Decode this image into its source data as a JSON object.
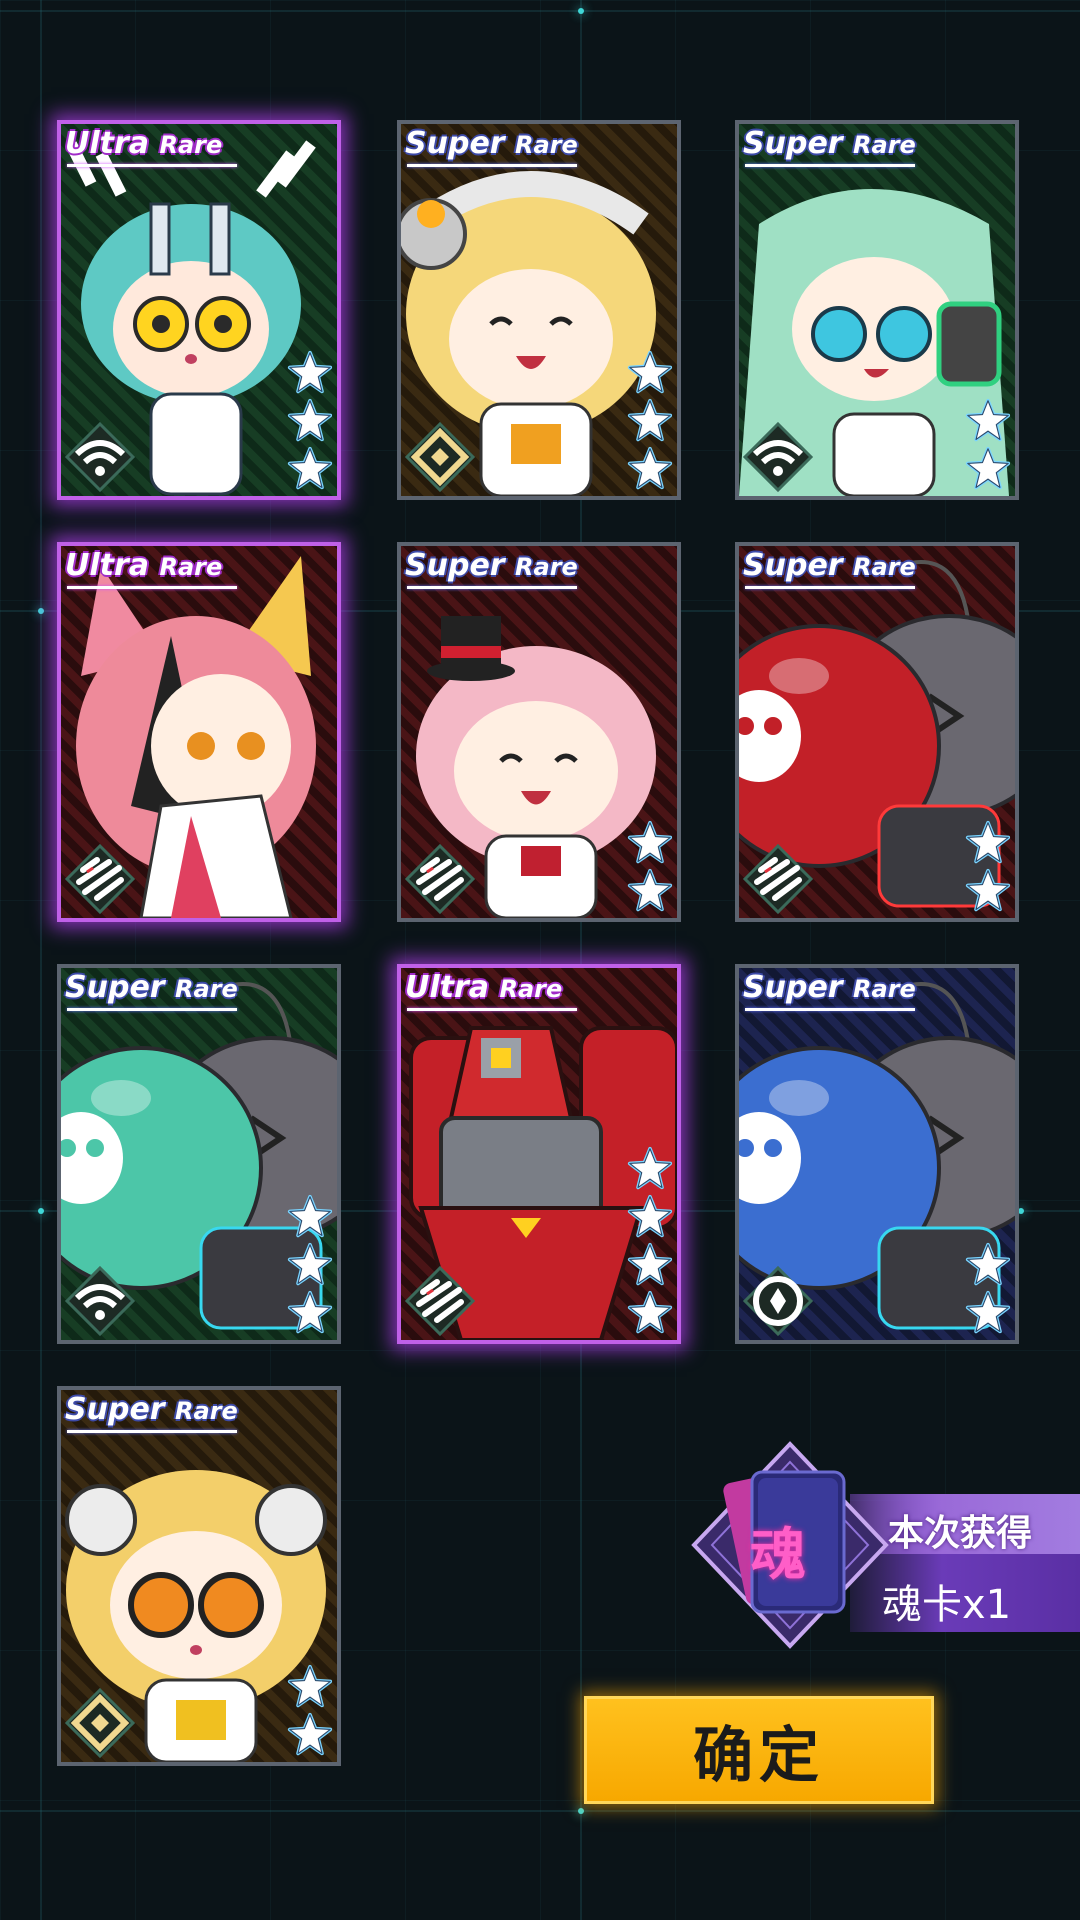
{
  "cards": [
    {
      "rarity_word1": "Ultra",
      "rarity_word2": "Rare",
      "tier": "ur",
      "stars": 3,
      "class_icon": "wifi-icon",
      "art": "cyan-hair-girl-horns",
      "bg": "green"
    },
    {
      "rarity_word1": "Super",
      "rarity_word2": "Rare",
      "tier": "sr",
      "stars": 3,
      "class_icon": "diamond-target-icon",
      "art": "blonde-girl-headphones",
      "bg": "orange"
    },
    {
      "rarity_word1": "Super",
      "rarity_word2": "Rare",
      "tier": "sr",
      "stars": 2,
      "class_icon": "wifi-icon",
      "art": "mint-hair-girl-headset",
      "bg": "green"
    },
    {
      "rarity_word1": "Ultra",
      "rarity_word2": "Rare",
      "tier": "ur",
      "stars": 0,
      "class_icon": "slash-stripes-icon",
      "art": "pink-fox-girl",
      "bg": "red"
    },
    {
      "rarity_word1": "Super",
      "rarity_word2": "Rare",
      "tier": "sr",
      "stars": 2,
      "class_icon": "slash-stripes-icon",
      "art": "pink-hair-girl-hat",
      "bg": "red"
    },
    {
      "rarity_word1": "Super",
      "rarity_word2": "Rare",
      "tier": "sr",
      "stars": 2,
      "class_icon": "slash-stripes-icon",
      "art": "red-skull-bomb-robot",
      "bg": "red"
    },
    {
      "rarity_word1": "Super",
      "rarity_word2": "Rare",
      "tier": "sr",
      "stars": 3,
      "class_icon": "wifi-icon",
      "art": "teal-skull-bomb-robot",
      "bg": "green"
    },
    {
      "rarity_word1": "Ultra",
      "rarity_word2": "Rare",
      "tier": "ur",
      "stars": 4,
      "class_icon": "slash-stripes-icon",
      "art": "red-mech-robot",
      "bg": "red"
    },
    {
      "rarity_word1": "Super",
      "rarity_word2": "Rare",
      "tier": "sr",
      "stars": 2,
      "class_icon": "circle-diamond-icon",
      "art": "blue-skull-bomb-robot",
      "bg": "blue"
    },
    {
      "rarity_word1": "Super",
      "rarity_word2": "Rare",
      "tier": "sr",
      "stars": 2,
      "class_icon": "diamond-target-icon",
      "art": "blonde-girl-glasses",
      "bg": "orange"
    }
  ],
  "reward": {
    "icon_char": "魂",
    "title": "本次获得",
    "count_label": "魂卡x1"
  },
  "confirm_label": "确定",
  "colors": {
    "ultra_glow": "#c060e8",
    "super_border": "#5c6470",
    "confirm": "#ffb400",
    "banner": "#6a3bb8"
  }
}
